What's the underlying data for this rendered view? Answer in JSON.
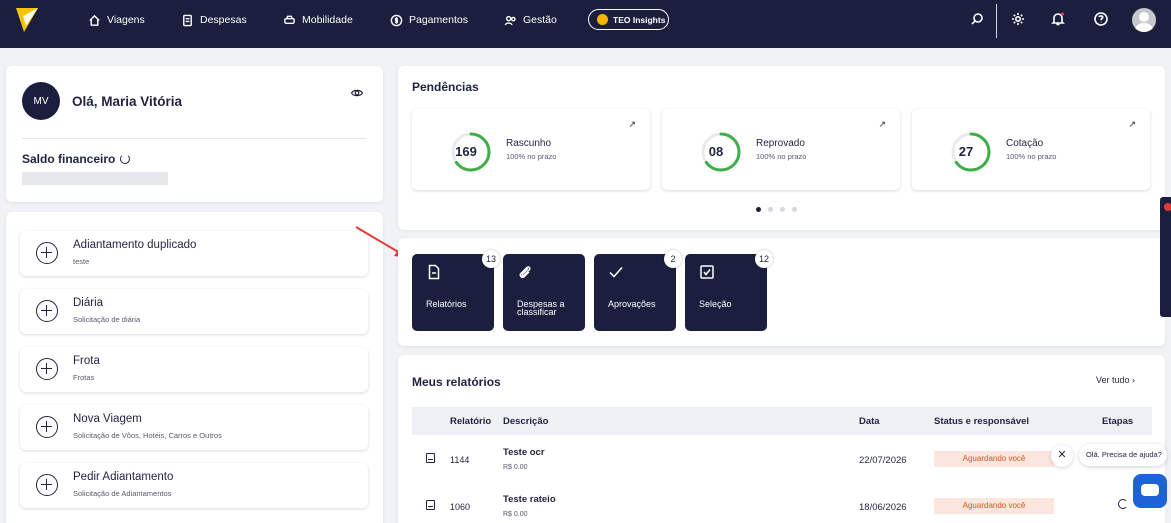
{
  "nav": {
    "items": [
      {
        "label": "Viagens",
        "icon": "home-icon"
      },
      {
        "label": "Despesas",
        "icon": "receipt-icon"
      },
      {
        "label": "Mobilidade",
        "icon": "car-icon"
      },
      {
        "label": "Pagamentos",
        "icon": "dollar-circle-icon"
      },
      {
        "label": "Gestão",
        "icon": "users-icon"
      }
    ],
    "teo_label": "TEO Insights",
    "right_icons": [
      "search-icon",
      "gear-icon",
      "bell-icon",
      "help-icon",
      "user-avatar-icon"
    ]
  },
  "greeting": {
    "initials": "MV",
    "text": "Olá, Maria Vitória",
    "saldo_label": "Saldo financeiro"
  },
  "shortcuts": [
    {
      "title": "Adiantamento duplicado",
      "subtitle": "teste"
    },
    {
      "title": "Diária",
      "subtitle": "Solicitação de diária"
    },
    {
      "title": "Frota",
      "subtitle": "Frotas"
    },
    {
      "title": "Nova Viagem",
      "subtitle": "Solicitação de Vôos, Hotéis, Carros e Outros"
    },
    {
      "title": "Pedir Adiantamento",
      "subtitle": "Solicitação de Adiantamentos"
    }
  ],
  "pendencias": {
    "title": "Pendências",
    "items": [
      {
        "value": "169",
        "label": "Rascunho",
        "pct": "100% no prazo",
        "progress": 0.65
      },
      {
        "value": "08",
        "label": "Reprovado",
        "pct": "100% no prazo",
        "progress": 0.65
      },
      {
        "value": "27",
        "label": "Cotação",
        "pct": "100% no prazo",
        "progress": 0.65
      }
    ],
    "page_dots": 4,
    "active_dot": 0,
    "arrow": "↗"
  },
  "quick": [
    {
      "label": "Relatórios",
      "badge": "13",
      "icon": "document-icon"
    },
    {
      "label": "Despesas a classificar",
      "label_line1": "Despesas a",
      "label_line2": "classificar",
      "badge": "",
      "icon": "paperclip-icon"
    },
    {
      "label": "Aprovações",
      "badge": "2",
      "icon": "check-icon"
    },
    {
      "label": "Seleção",
      "badge": "12",
      "icon": "checkbox-icon"
    }
  ],
  "relatorios": {
    "title": "Meus relatórios",
    "see_all": "Ver tudo",
    "columns": [
      "Relatório",
      "Descrição",
      "Data",
      "Status e responsável",
      "Etapas"
    ],
    "rows": [
      {
        "id": "1144",
        "desc": "Teste ocr",
        "value": "R$ 0.00",
        "date": "22/07/2026",
        "status": "Aguardando você"
      },
      {
        "id": "1060",
        "desc": "Teste rateio",
        "value": "R$ 0.00",
        "date": "18/06/2026",
        "status": "Aguardando você"
      }
    ]
  },
  "chat": {
    "tooltip": "Olá. Precisa de ajuda?",
    "close": "✕"
  },
  "colors": {
    "navy": "#1b1f3d",
    "progress_green": "#3fae49",
    "status_bg": "#fbe6de",
    "status_text": "#d4561c",
    "annotation_arrow": "#e53935"
  }
}
